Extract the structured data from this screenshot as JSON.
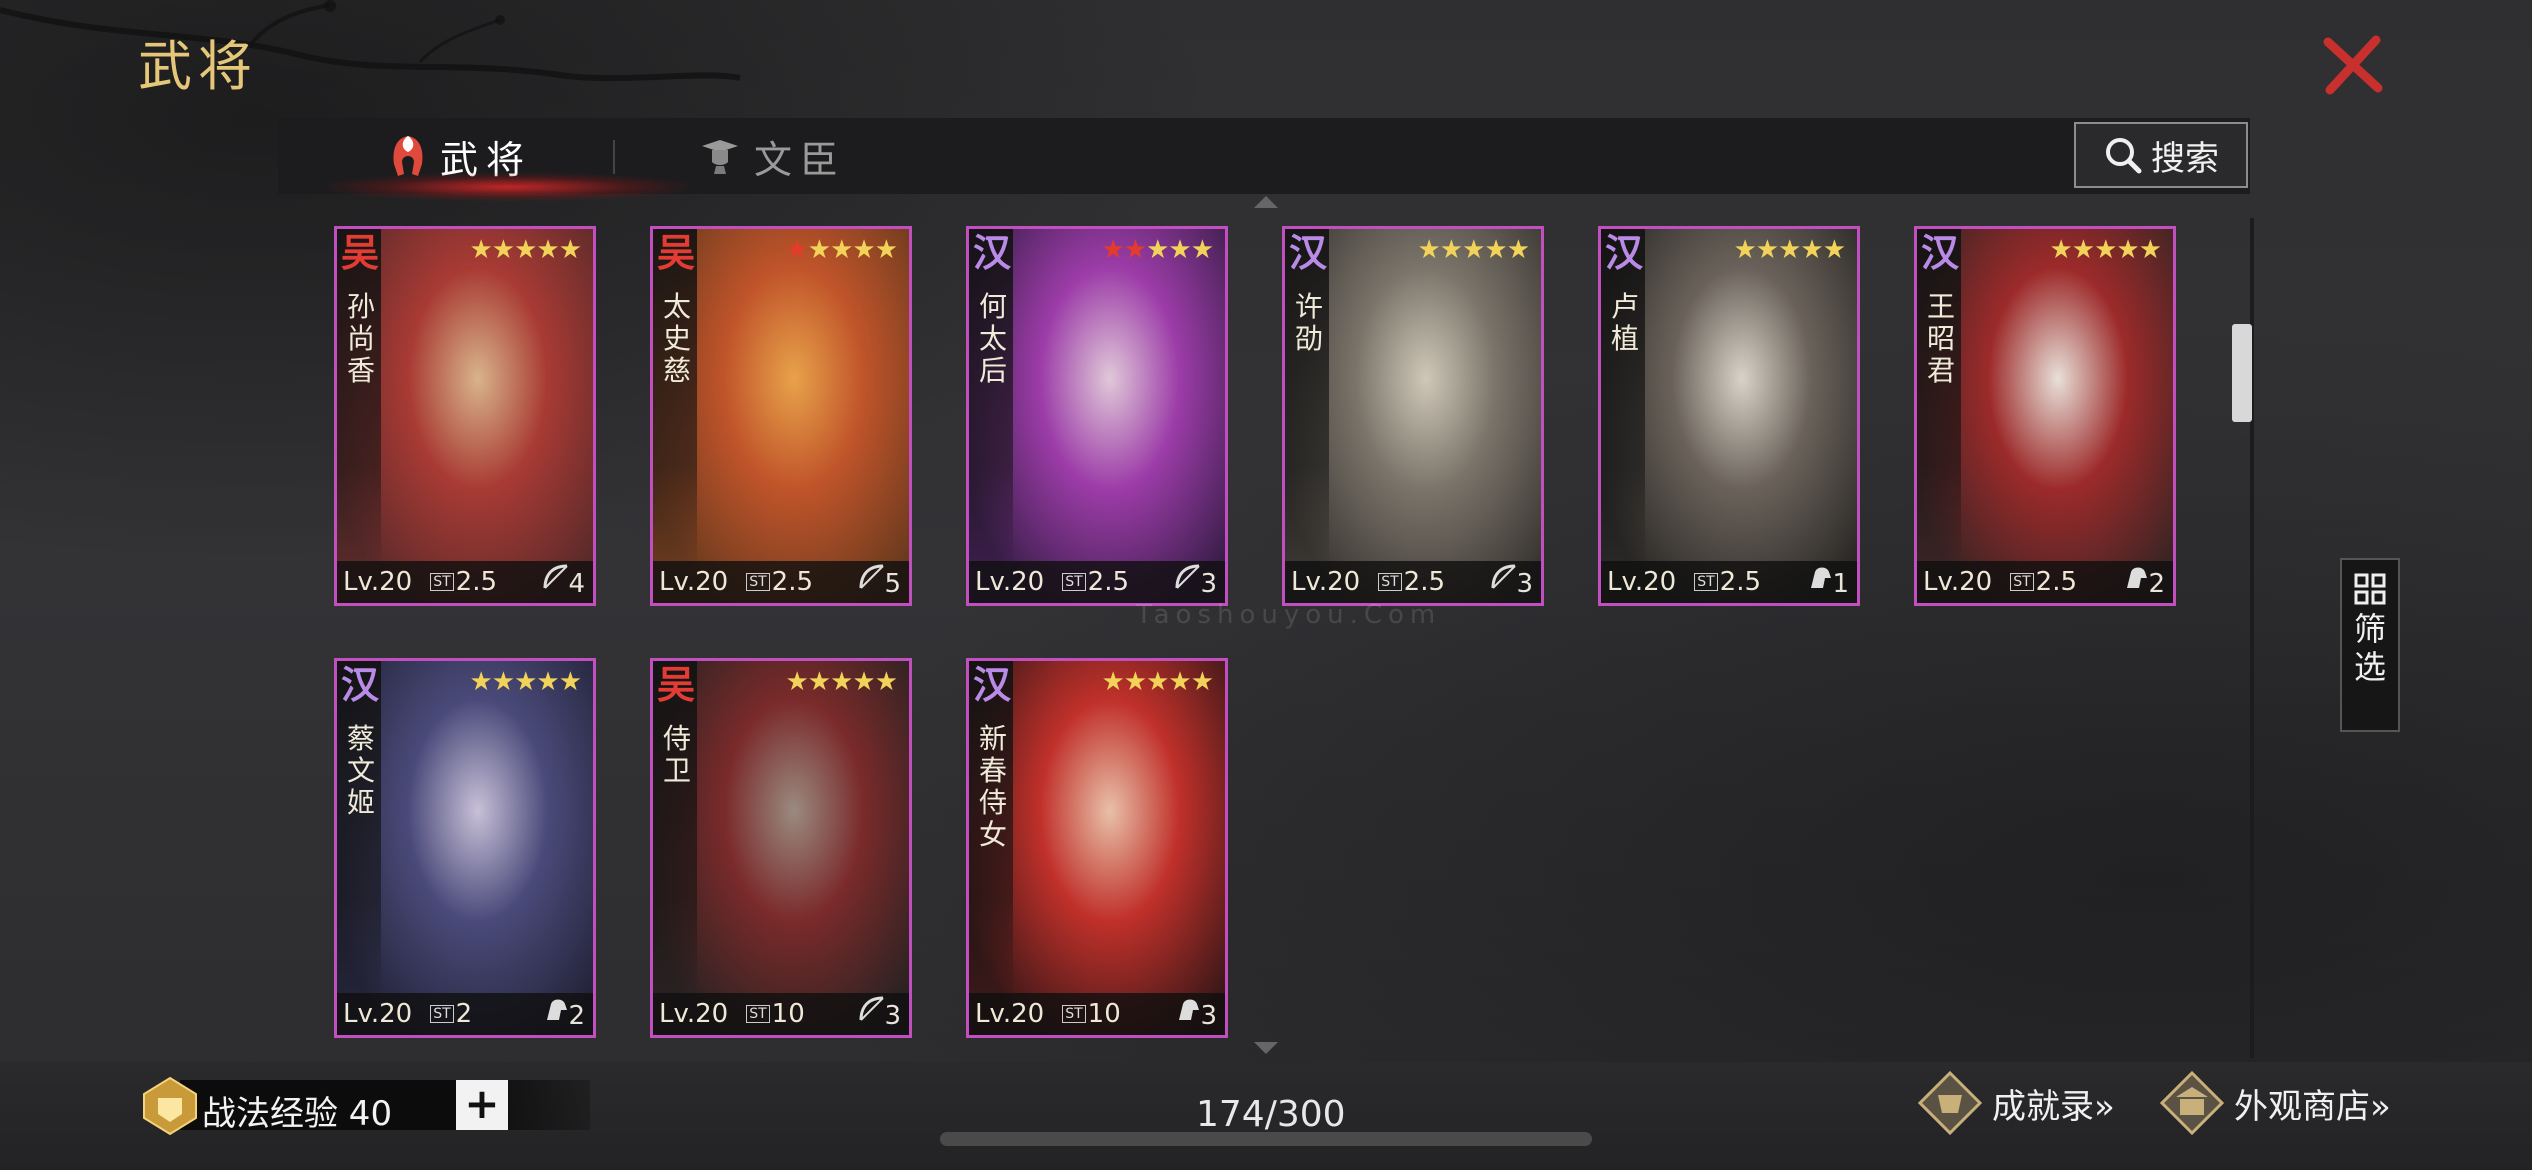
{
  "page": {
    "title": "武将"
  },
  "tabs": [
    {
      "label": "武将",
      "icon": "helmet-icon",
      "active": true
    },
    {
      "label": "文臣",
      "icon": "scholar-hat-icon",
      "active": false
    }
  ],
  "search": {
    "label": "搜索",
    "icon": "search-icon"
  },
  "filter": {
    "label": "筛选",
    "icon": "grid-icon"
  },
  "colors": {
    "accent_gold": "#e6c77a",
    "card_border": "#c24fc0",
    "faction_wu": "#e23c34",
    "faction_han": "#b98ae6",
    "star_yellow": "#f2d35a",
    "star_red": "#e33b2c",
    "close_red": "#c8302e"
  },
  "cards": [
    {
      "faction": "吴",
      "name": "孙尚香",
      "red_stars": 0,
      "stars": 5,
      "level": "Lv.20",
      "cost": "2.5",
      "unit": "bow-icon",
      "count": "4"
    },
    {
      "faction": "吴",
      "name": "太史慈",
      "red_stars": 1,
      "stars": 5,
      "level": "Lv.20",
      "cost": "2.5",
      "unit": "bow-icon",
      "count": "5"
    },
    {
      "faction": "汉",
      "name": "何太后",
      "red_stars": 2,
      "stars": 5,
      "level": "Lv.20",
      "cost": "2.5",
      "unit": "bow-icon",
      "count": "3"
    },
    {
      "faction": "汉",
      "name": "许劭",
      "red_stars": 0,
      "stars": 5,
      "level": "Lv.20",
      "cost": "2.5",
      "unit": "bow-icon",
      "count": "3"
    },
    {
      "faction": "汉",
      "name": "卢植",
      "red_stars": 0,
      "stars": 5,
      "level": "Lv.20",
      "cost": "2.5",
      "unit": "horse-icon",
      "count": "1"
    },
    {
      "faction": "汉",
      "name": "王昭君",
      "red_stars": 0,
      "stars": 5,
      "level": "Lv.20",
      "cost": "2.5",
      "unit": "horse-icon",
      "count": "2"
    },
    {
      "faction": "汉",
      "name": "蔡文姬",
      "red_stars": 0,
      "stars": 5,
      "level": "Lv.20",
      "cost": "2",
      "unit": "horse-icon",
      "count": "2"
    },
    {
      "faction": "吴",
      "name": "侍卫",
      "red_stars": 0,
      "stars": 5,
      "level": "Lv.20",
      "cost": "10",
      "unit": "bow-icon",
      "count": "3"
    },
    {
      "faction": "汉",
      "name": "新春侍女",
      "red_stars": 0,
      "stars": 5,
      "level": "Lv.20",
      "cost": "10",
      "unit": "horse-icon",
      "count": "3"
    }
  ],
  "cost_icon_label": "ST",
  "bottom": {
    "exp_label": "战法经验 40",
    "plus_label": "+",
    "total": "174/300",
    "achievements": "成就录»",
    "shop": "外观商店»"
  },
  "watermark": "Taoshouyou.Com"
}
